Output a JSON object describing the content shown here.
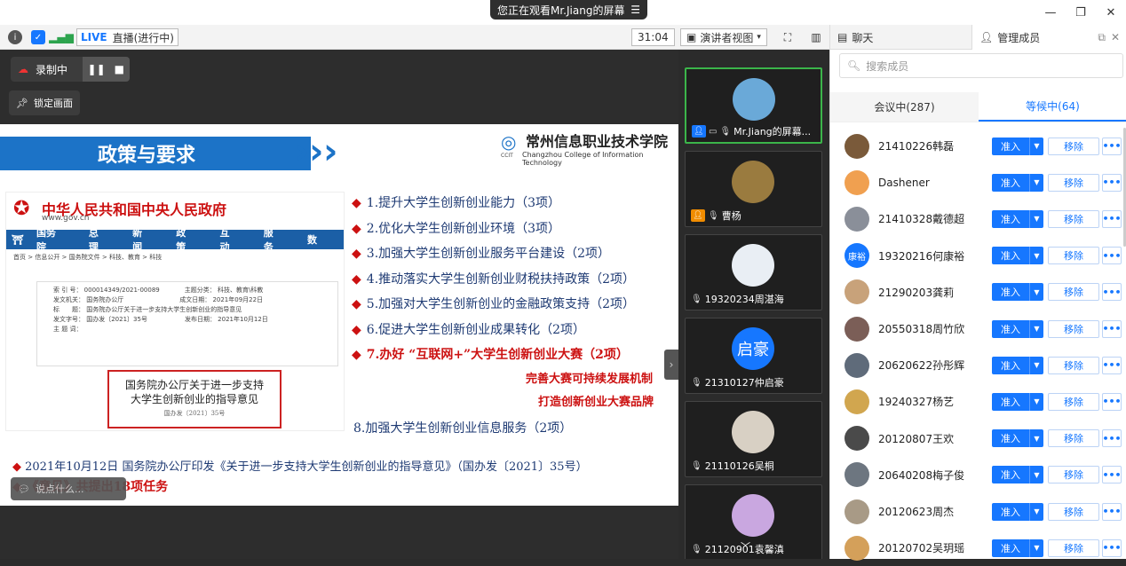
{
  "window": {
    "share_banner": "您正在观看Mr.Jiang的屏幕"
  },
  "toolbar": {
    "live_tag": "LIVE",
    "live_status": "直播(进行中)",
    "timer": "31:04",
    "view_mode": "演讲者视图"
  },
  "recording": {
    "label": "录制中",
    "lock_label": "锁定画面"
  },
  "slide": {
    "banner_title": "政策与要求",
    "school_cn": "常州信息职业技术学院",
    "school_en": "Changzhou College of Information Technology",
    "school_abbr": "CCIT",
    "gov_title": "中华人民共和国中央人民政府",
    "gov_url": "www.gov.cn",
    "gov_nav": [
      "国务院",
      "总理",
      "新闻",
      "政策",
      "互动",
      "服务",
      "数"
    ],
    "gov_breadcrumb": "首页 > 信息公开 > 国务院文件 > 科技、教育 > 科技",
    "gov_meta": [
      "索 引 号： 000014349/2021-00089　　　　主题分类： 科技、教育\\科教",
      "发文机关： 国务院办公厅　　　　　　　　　成文日期： 2021年09月22日",
      "标　　题： 国务院办公厅关于进一步支持大学生创新创业的指导意见",
      "发文字号： 国办发〔2021〕35号　　　　　　发布日期： 2021年10月12日",
      "主 题 词："
    ],
    "gov_doc_title_1": "国务院办公厅关于进一步支持",
    "gov_doc_title_2": "大学生创新创业的指导意见",
    "gov_doc_no": "国办发〔2021〕35号",
    "policies": [
      "1.提升大学生创新创业能力（3项）",
      "2.优化大学生创新创业环境（3项）",
      "3.加强大学生创新创业服务平台建设（2项）",
      "4.推动落实大学生创新创业财税扶持政策（2项）",
      "5.加强对大学生创新创业的金融政策支持（2项）",
      "6.促进大学生创新创业成果转化（2项）",
      "7.办好 “互联网+”大学生创新创业大赛（2项）"
    ],
    "sub_1": "完善大赛可持续发展机制",
    "sub_2": "打造创新创业大赛品牌",
    "policy_8": "8.加强大学生创新创业信息服务（2项）",
    "footnote_1": "2021年10月12日 国务院办公厅印发《关于进一步支持大学生创新创业的指导意见》（国办发〔2021〕35号）",
    "footnote_2": "《意见》共提出18项任务",
    "say_placeholder": "说点什么..."
  },
  "gallery": [
    {
      "name": "Mr.Jiang的屏幕...",
      "avatar_text": "",
      "color": "#6aa9d8",
      "active": true
    },
    {
      "name": "曹杨",
      "avatar_text": "",
      "color": "#9a7b3f",
      "active": false
    },
    {
      "name": "19320234周湛海",
      "avatar_text": "",
      "color": "#e9eef4",
      "active": false
    },
    {
      "name": "21310127仲启豪",
      "avatar_text": "启豪",
      "color": "#1677ff",
      "active": false
    },
    {
      "name": "21110126吴桐",
      "avatar_text": "",
      "color": "#d8d0c4",
      "active": false
    },
    {
      "name": "21120901袁馨滇",
      "avatar_text": "",
      "color": "#c9a7e0",
      "active": false
    }
  ],
  "panel": {
    "chat_tab": "聊天",
    "members_tab": "管理成员",
    "search_placeholder": "搜索成员",
    "in_meeting_tab": "会议中(287)",
    "waiting_tab": "等候中(64)",
    "admit_label": "准入",
    "remove_label": "移除",
    "more_label": "•••",
    "members": [
      {
        "name": "21410226韩磊",
        "avatar_text": "",
        "color": "#7a5a3a"
      },
      {
        "name": "Dashener",
        "avatar_text": "",
        "color": "#f0a050"
      },
      {
        "name": "21410328戴德超",
        "avatar_text": "",
        "color": "#8a8f99"
      },
      {
        "name": "19320216何康裕",
        "avatar_text": "康裕",
        "color": "#1677ff"
      },
      {
        "name": "21290203龚莉",
        "avatar_text": "",
        "color": "#c8a27a"
      },
      {
        "name": "20550318周竹欣",
        "avatar_text": "",
        "color": "#7b5e57"
      },
      {
        "name": "20620622孙彤辉",
        "avatar_text": "",
        "color": "#5f6b7a"
      },
      {
        "name": "19240327杨艺",
        "avatar_text": "",
        "color": "#d1a64f"
      },
      {
        "name": "20120807王欢",
        "avatar_text": "",
        "color": "#4a4a4a"
      },
      {
        "name": "20640208梅子俊",
        "avatar_text": "",
        "color": "#6d7680"
      },
      {
        "name": "20120623周杰",
        "avatar_text": "",
        "color": "#a89a86"
      },
      {
        "name": "20120702吴玥瑶",
        "avatar_text": "",
        "color": "#d4a05a"
      }
    ]
  }
}
